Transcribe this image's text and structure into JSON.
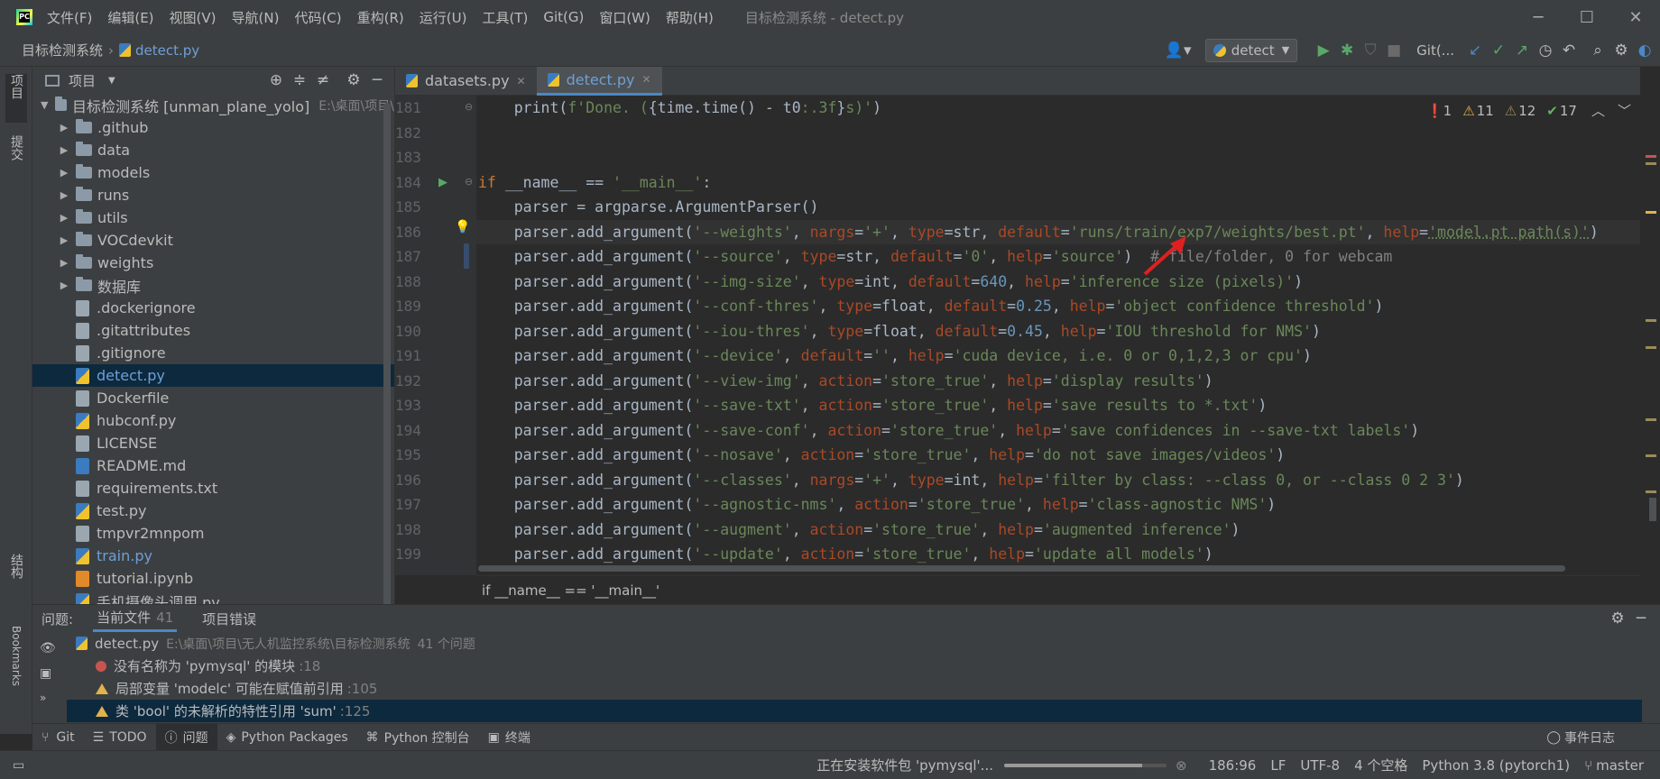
{
  "titlebar": {
    "menus": [
      "文件(F)",
      "编辑(E)",
      "视图(V)",
      "导航(N)",
      "代码(C)",
      "重构(R)",
      "运行(U)",
      "工具(T)",
      "Git(G)",
      "窗口(W)",
      "帮助(H)"
    ],
    "title": "目标检测系统 - detect.py"
  },
  "navbar": {
    "project": "目标检测系统",
    "file": "detect.py",
    "run_config": "detect",
    "git_label": "Git(..."
  },
  "leftstrip": {
    "project_label": "项目",
    "commit_label": "提交",
    "structure_label": "结构",
    "bookmarks_label": "Bookmarks"
  },
  "project": {
    "header": "项目",
    "root": {
      "name": "目标检测系统 [unman_plane_yolo]",
      "path": "E:\\桌面\\项目\\"
    },
    "items": [
      {
        "name": ".github",
        "type": "folder"
      },
      {
        "name": "data",
        "type": "folder"
      },
      {
        "name": "models",
        "type": "folder"
      },
      {
        "name": "runs",
        "type": "folder"
      },
      {
        "name": "utils",
        "type": "folder"
      },
      {
        "name": "VOCdevkit",
        "type": "folder"
      },
      {
        "name": "weights",
        "type": "folder"
      },
      {
        "name": "数据库",
        "type": "folder"
      },
      {
        "name": ".dockerignore",
        "type": "txt"
      },
      {
        "name": ".gitattributes",
        "type": "git"
      },
      {
        "name": ".gitignore",
        "type": "git"
      },
      {
        "name": "detect.py",
        "type": "py"
      },
      {
        "name": "Dockerfile",
        "type": "txt"
      },
      {
        "name": "hubconf.py",
        "type": "py"
      },
      {
        "name": "LICENSE",
        "type": "txt"
      },
      {
        "name": "README.md",
        "type": "md"
      },
      {
        "name": "requirements.txt",
        "type": "txt"
      },
      {
        "name": "test.py",
        "type": "py"
      },
      {
        "name": "tmpvr2mnpom",
        "type": "txt"
      },
      {
        "name": "train.py",
        "type": "py"
      },
      {
        "name": "tutorial.ipynb",
        "type": "nb"
      },
      {
        "name": "手机摄像头调用.py",
        "type": "py"
      }
    ]
  },
  "tabs": [
    "datasets.py",
    "detect.py"
  ],
  "inspections": {
    "errors": "1",
    "warnings": "11",
    "weak": "12",
    "ok": "17"
  },
  "editor": {
    "line_numbers": [
      "181",
      "182",
      "183",
      "184",
      "185",
      "186",
      "187",
      "188",
      "189",
      "190",
      "191",
      "192",
      "193",
      "194",
      "195",
      "196",
      "197",
      "198",
      "199"
    ],
    "breadcrumb": "if __name__ == '__main__'"
  },
  "problems": {
    "label": "问题:",
    "tab_current": "当前文件",
    "tab_current_count": "41",
    "tab_project": "项目错误",
    "file": "detect.py",
    "file_path": "E:\\桌面\\项目\\无人机监控系统\\目标检测系统",
    "file_count": "41 个问题",
    "rows": [
      {
        "text": "没有名称为 'pymysql' 的模块",
        "line": ":18",
        "severity": "error"
      },
      {
        "text": "局部变量 'modelc' 可能在赋值前引用",
        "line": ":105",
        "severity": "warning"
      },
      {
        "text": "类 'bool' 的未解析的特性引用 'sum'",
        "line": ":125",
        "severity": "warning"
      }
    ]
  },
  "tooltabs": [
    "Git",
    "TODO",
    "问题",
    "Python Packages",
    "Python 控制台",
    "终端"
  ],
  "event_log": "事件日志",
  "status": {
    "installing": "正在安装软件包 'pymysql'...",
    "progress": 0.85,
    "position": "186:96",
    "line_sep": "LF",
    "encoding": "UTF-8",
    "indent": "4 个空格",
    "interpreter": "Python 3.8 (pytorch1)",
    "branch": "master"
  }
}
